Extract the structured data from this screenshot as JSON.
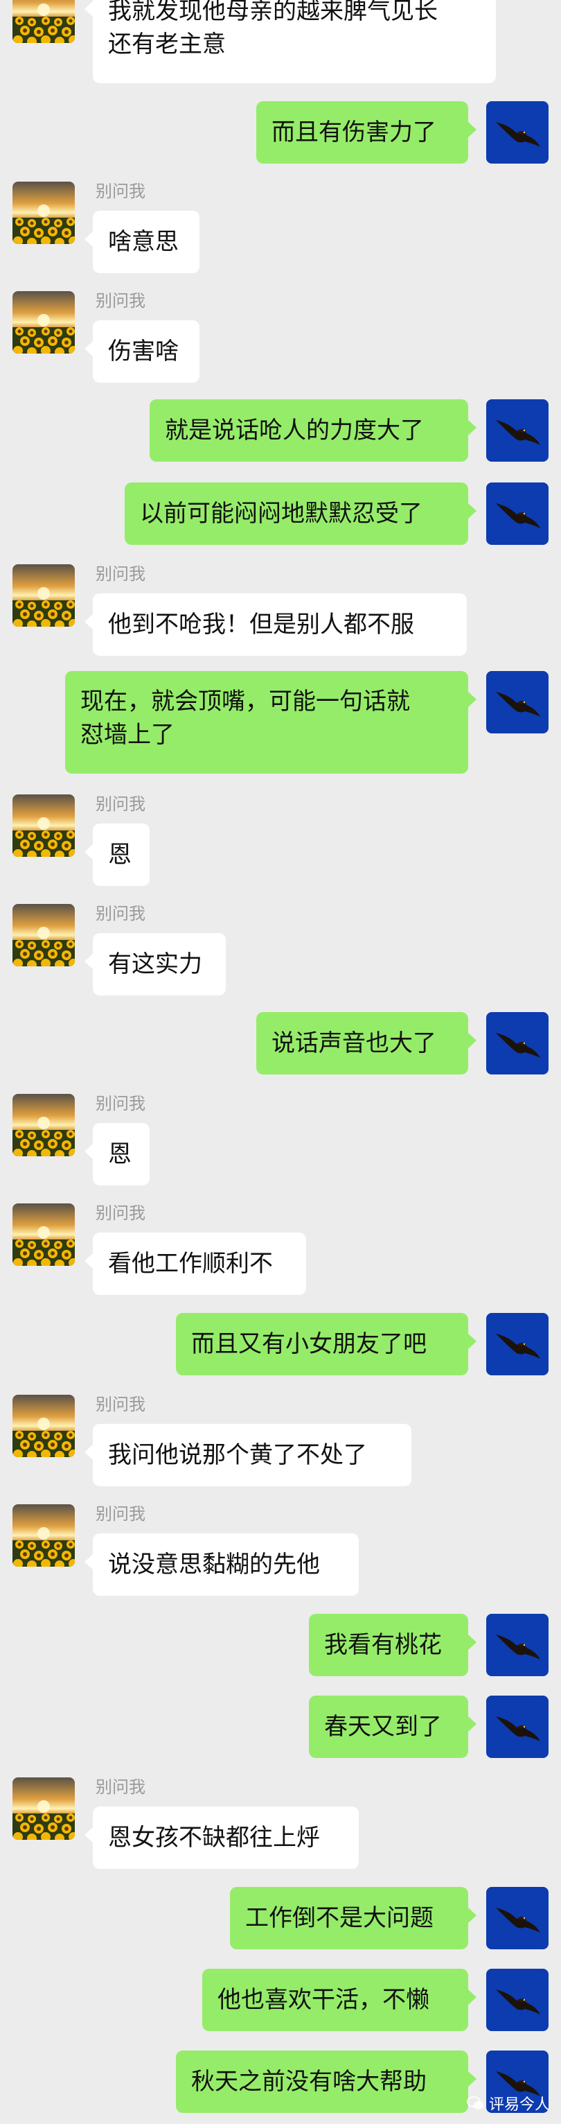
{
  "contact_name": "别问我",
  "colors": {
    "background": "#ececec",
    "bubble_in": "#ffffff",
    "bubble_out": "#95ec69",
    "avatar_out_bg": "#0d3cb0"
  },
  "icons": {
    "incoming_avatar": "sunflower-sunset-avatar",
    "outgoing_avatar": "eagle-on-blue-avatar"
  },
  "messages": [
    {
      "from": "other",
      "text": "我就发现他母亲的越来脾气见长\n还有老主意"
    },
    {
      "from": "me",
      "text": "而且有伤害力了"
    },
    {
      "from": "other",
      "sender": "别问我",
      "text": "啥意思"
    },
    {
      "from": "other",
      "sender": "别问我",
      "text": "伤害啥"
    },
    {
      "from": "me",
      "text": "就是说话呛人的力度大了"
    },
    {
      "from": "me",
      "text": "以前可能闷闷地默默忍受了"
    },
    {
      "from": "other",
      "sender": "别问我",
      "text": "他到不呛我！但是别人都不服"
    },
    {
      "from": "me",
      "text": "现在，就会顶嘴，可能一句话就\n怼墙上了"
    },
    {
      "from": "other",
      "sender": "别问我",
      "text": "恩"
    },
    {
      "from": "other",
      "sender": "别问我",
      "text": "有这实力"
    },
    {
      "from": "me",
      "text": "说话声音也大了"
    },
    {
      "from": "other",
      "sender": "别问我",
      "text": "恩"
    },
    {
      "from": "other",
      "sender": "别问我",
      "text": "看他工作顺利不"
    },
    {
      "from": "me",
      "text": "而且又有小女朋友了吧"
    },
    {
      "from": "other",
      "sender": "别问我",
      "text": "我问他说那个黄了不处了"
    },
    {
      "from": "other",
      "sender": "别问我",
      "text": "说没意思黏糊的先他"
    },
    {
      "from": "me",
      "text": "我看有桃花"
    },
    {
      "from": "me",
      "text": "春天又到了"
    },
    {
      "from": "other",
      "sender": "别问我",
      "text": "恩女孩不缺都往上烀"
    },
    {
      "from": "me",
      "text": "工作倒不是大问题"
    },
    {
      "from": "me",
      "text": "他也喜欢干活，不懒"
    },
    {
      "from": "me",
      "text": "秋天之前没有啥大帮助"
    }
  ],
  "watermark": {
    "text": "评易今人"
  }
}
